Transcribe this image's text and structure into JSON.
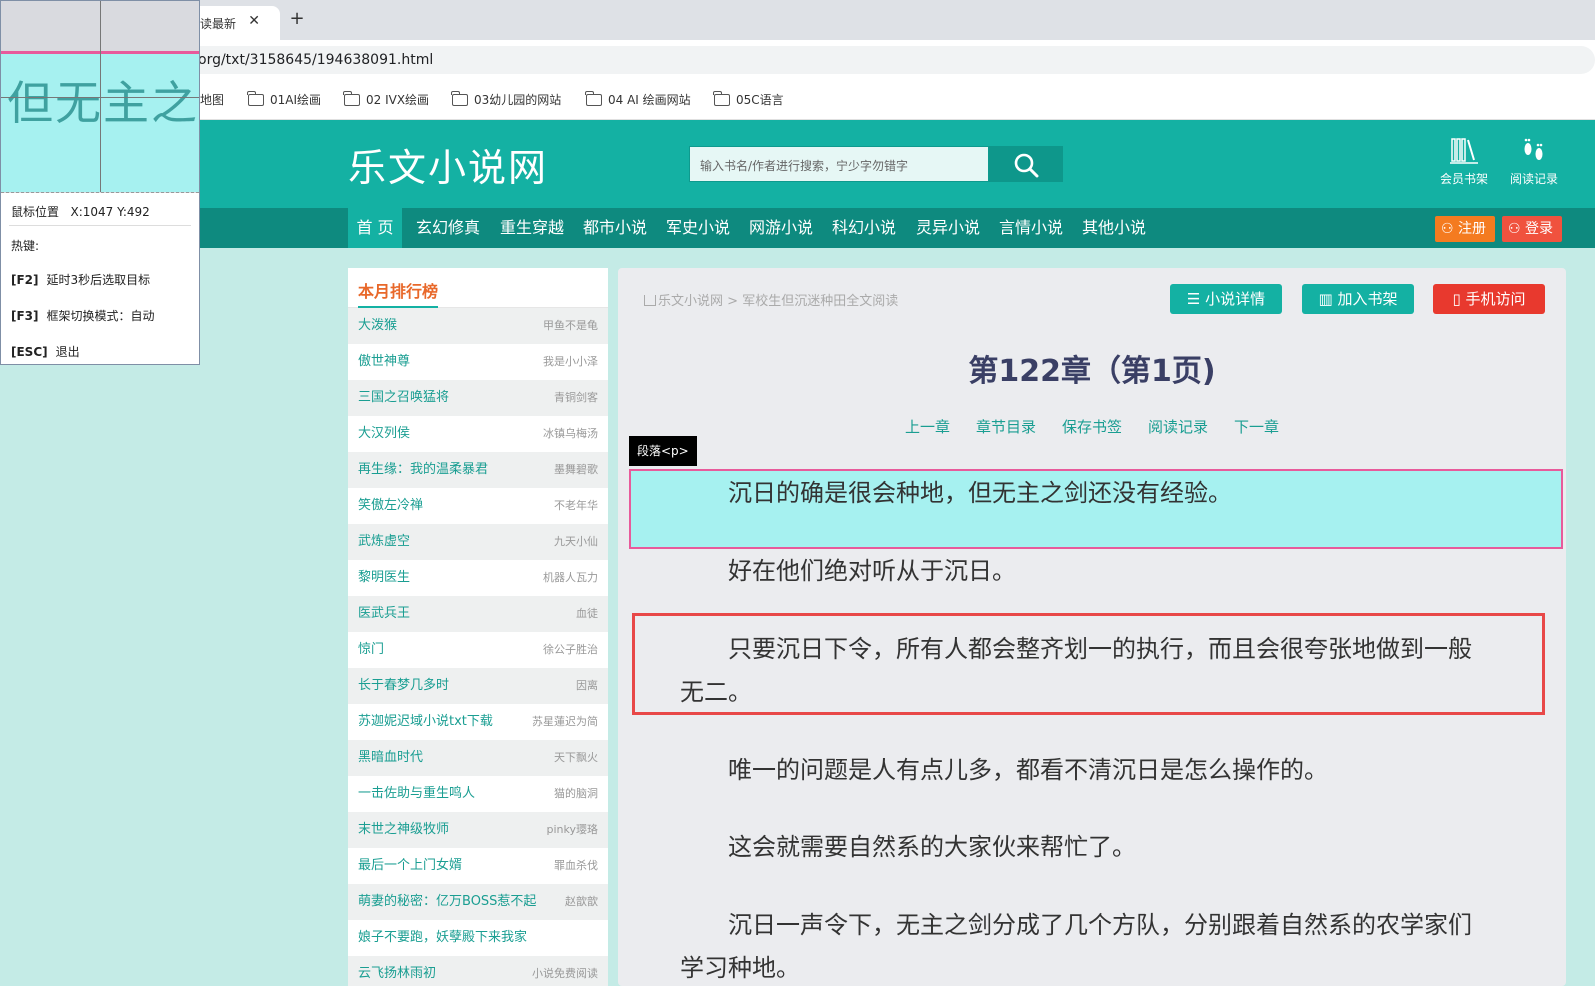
{
  "browser": {
    "tab_title": "读最新",
    "url": "org/txt/3158645/194638091.html",
    "bookmarks": [
      "地图",
      "01AI绘画",
      "02 IVX绘画",
      "03幼儿园的网站",
      "04 AI 绘画网站",
      "05C语言"
    ]
  },
  "header": {
    "logo": "乐文小说网",
    "search_placeholder": "输入书名/作者进行搜索，宁少字勿错字",
    "member_shelf": "会员书架",
    "reading_history": "阅读记录"
  },
  "nav": {
    "items": [
      "首 页",
      "玄幻修真",
      "重生穿越",
      "都市小说",
      "军史小说",
      "网游小说",
      "科幻小说",
      "灵异小说",
      "言情小说",
      "其他小说"
    ],
    "register": "注册",
    "login": "登录"
  },
  "ranking": {
    "title": "本月排行榜",
    "rows": [
      {
        "name": "大泼猴",
        "author": "甲鱼不是龟"
      },
      {
        "name": "傲世神尊",
        "author": "我是小小泽"
      },
      {
        "name": "三国之召唤猛将",
        "author": "青铜剑客"
      },
      {
        "name": "大汉列侯",
        "author": "冰镇乌梅汤"
      },
      {
        "name": "再生缘：我的温柔暴君",
        "author": "墨舞碧歌"
      },
      {
        "name": "笑傲左冷禅",
        "author": "不老年华"
      },
      {
        "name": "武炼虚空",
        "author": "九天小仙"
      },
      {
        "name": "黎明医生",
        "author": "机器人瓦力"
      },
      {
        "name": "医武兵王",
        "author": "血徒"
      },
      {
        "name": "惊门",
        "author": "徐公子胜治"
      },
      {
        "name": "长于春梦几多时",
        "author": "因离"
      },
      {
        "name": "苏迦妮迟域小说txt下载",
        "author": "苏星蓮迟为简"
      },
      {
        "name": "黑暗血时代",
        "author": "天下飘火"
      },
      {
        "name": "一击佐助与重生鸣人",
        "author": "猫的脑洞"
      },
      {
        "name": "末世之神级牧师",
        "author": "pinky璎珞"
      },
      {
        "name": "最后一个上门女婿",
        "author": "罪血杀伐"
      },
      {
        "name": "萌妻的秘密：亿万BOSS惹不起",
        "author": "赵歆歆"
      },
      {
        "name": "娘子不要跑，妖孽殿下来我家",
        "author": ""
      },
      {
        "name": "云飞扬林雨初",
        "author": "小说免费阅读"
      }
    ]
  },
  "reader": {
    "breadcrumb_home": "乐文小说网",
    "breadcrumb_sep": ">",
    "breadcrumb_book": "军校生但沉迷种田全文阅读",
    "btn_detail": "小说详情",
    "btn_shelf": "加入书架",
    "btn_mobile": "手机访问",
    "chapter_title": "第122章（第1页)",
    "chapter_nav": [
      "上一章",
      "章节目录",
      "保存书签",
      "阅读记录",
      "下一章"
    ],
    "paragraphs": [
      "沉日的确是很会种地，但无主之剑还没有经验。",
      "好在他们绝对听从于沉日。",
      "只要沉日下令，所有人都会整齐划一的执行，而且会很夸张地做到一般无二。",
      "唯一的问题是人有点儿多，都看不清沉日是怎么操作的。",
      "这会就需要自然系的大家伙来帮忙了。",
      "沉日一声令下，无主之剑分成了几个方队，分别跟着自然系的农学家们学习种地。"
    ]
  },
  "picker_tool": {
    "magnifier_text": "但无主之",
    "mouse_pos_label": "鼠标位置",
    "mouse_pos_value": "X:1047 Y:492",
    "hotkeys_label": "热键:",
    "f2_key": "[F2]",
    "f2_desc": "延时3秒后选取目标",
    "f3_key": "[F3]",
    "f3_desc": "框架切换模式：自动",
    "esc_key": "[ESC]",
    "esc_desc": "退出",
    "element_tag_label": "段落<p>"
  },
  "colors": {
    "brand": "#14b1a3",
    "nav_dark": "#0e8a7f",
    "register_orange": "#f47b20",
    "login_red": "#f0523e",
    "mobile_red": "#e8392e",
    "highlight_cyan": "#a6f1f0",
    "highlight_border_pink": "#e85a9b",
    "annotation_red": "#e84848"
  }
}
